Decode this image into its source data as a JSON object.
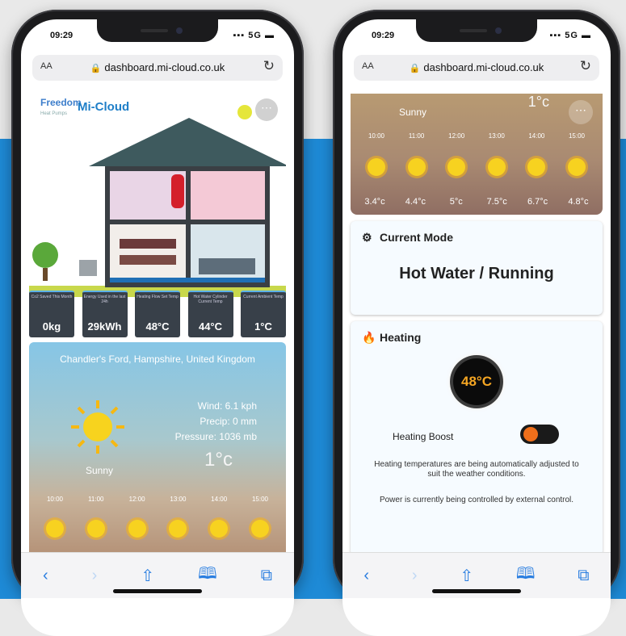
{
  "status": {
    "time": "09:29",
    "signal": "5G"
  },
  "browser": {
    "aa": "AA",
    "url": "dashboard.mi-cloud.co.uk"
  },
  "left": {
    "logo_brand": "Freedom",
    "logo_sub": "Heat Pumps",
    "logo_product": "Mi-Cloud",
    "stats": [
      {
        "label": "Co2 Saved This Month",
        "value": "0kg"
      },
      {
        "label": "Energy Used in the last 24h",
        "value": "29kWh"
      },
      {
        "label": "Heating Flow Set Temp",
        "value": "48°C"
      },
      {
        "label": "Hot Water Cylinder Current Temp",
        "value": "44°C"
      },
      {
        "label": "Current Ambient Temp",
        "value": "1°C"
      }
    ],
    "weather": {
      "location": "Chandler's Ford, Hampshire, United Kingdom",
      "wind": "Wind: 6.1 kph",
      "precip": "Precip: 0 mm",
      "pressure": "Pressure: 1036 mb",
      "temp": "1°c",
      "condition": "Sunny",
      "hours": [
        "10:00",
        "11:00",
        "12:00",
        "13:00",
        "14:00",
        "15:00"
      ]
    }
  },
  "right": {
    "weather": {
      "temp": "1°c",
      "condition": "Sunny",
      "hours": [
        "10:00",
        "11:00",
        "12:00",
        "13:00",
        "14:00",
        "15:00"
      ],
      "temps": [
        "3.4°c",
        "4.4°c",
        "5°c",
        "7.5°c",
        "6.7°c",
        "4.8°c"
      ]
    },
    "mode": {
      "title": "Current Mode",
      "value": "Hot Water / Running"
    },
    "heating": {
      "title": "Heating",
      "gauge": "48°C",
      "boost_label": "Heating Boost",
      "note1": "Heating temperatures are being automatically adjusted to suit the weather conditions.",
      "note2": "Power is currently being controlled by external control."
    }
  },
  "toolbar": {
    "back": "‹",
    "forward": "›",
    "share": "⇧",
    "bookmarks": "📖",
    "tabs": "⧉"
  },
  "colors": {
    "accent": "#2a7ee0",
    "band": "#1e8ad6",
    "boost_knob": "#ef6f1b"
  }
}
